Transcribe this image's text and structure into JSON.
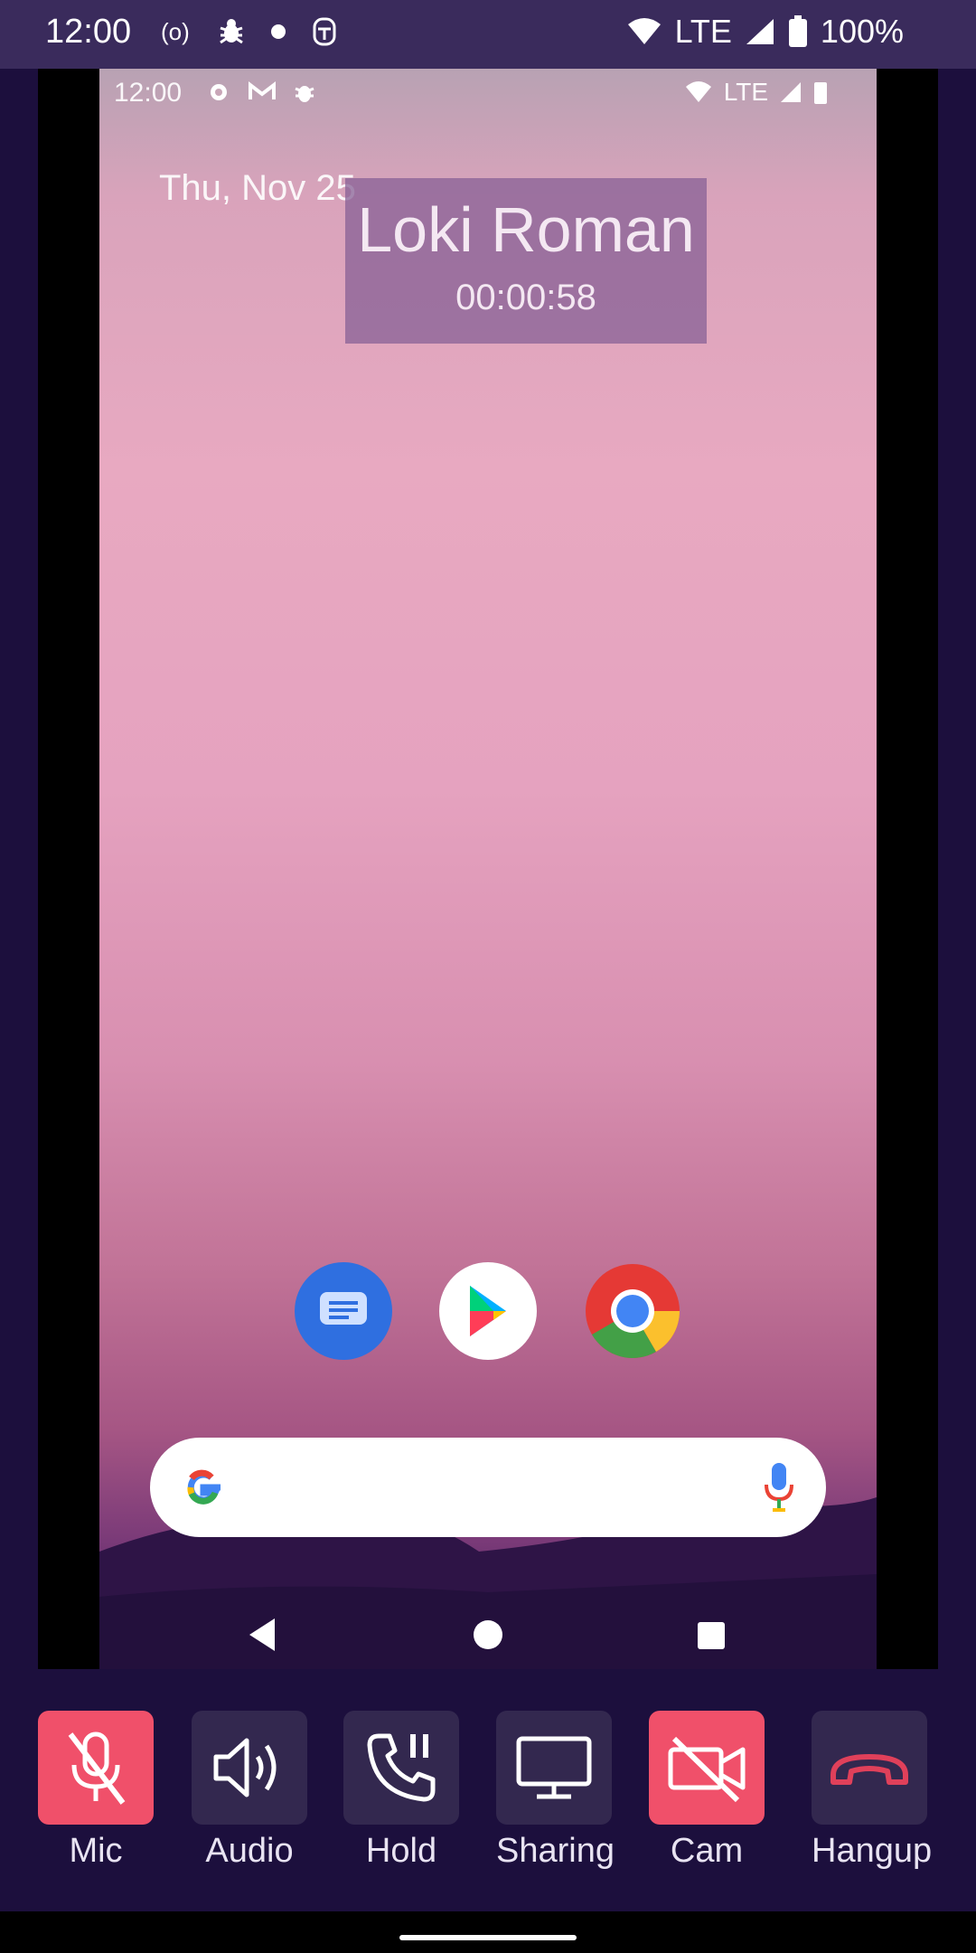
{
  "status_bar": {
    "time": "12:00",
    "network": "LTE",
    "battery": "100%",
    "icons": [
      "radio-icon",
      "bug-icon",
      "dot-icon",
      "accessibility-icon",
      "wifi-icon",
      "signal-icon",
      "battery-icon"
    ]
  },
  "shared_screen": {
    "status": {
      "time": "12:00",
      "network": "LTE"
    },
    "date": "Thu, Nov 25",
    "dock_apps": [
      "messages-icon",
      "play-store-icon",
      "chrome-icon"
    ]
  },
  "call": {
    "caller_name": "Loki Roman",
    "duration": "00:00:58"
  },
  "controls": [
    {
      "key": "mic",
      "label": "Mic",
      "active": true
    },
    {
      "key": "audio",
      "label": "Audio",
      "active": false
    },
    {
      "key": "hold",
      "label": "Hold",
      "active": false
    },
    {
      "key": "sharing",
      "label": "Sharing",
      "active": false
    },
    {
      "key": "cam",
      "label": "Cam",
      "active": true
    },
    {
      "key": "hangup",
      "label": "Hangup",
      "active": false
    }
  ],
  "colors": {
    "background": "#1c0f3d",
    "status_bar": "#3a2b5c",
    "control_default": "#33284f",
    "control_active": "#f0506a",
    "hangup_icon": "#e0405a"
  }
}
